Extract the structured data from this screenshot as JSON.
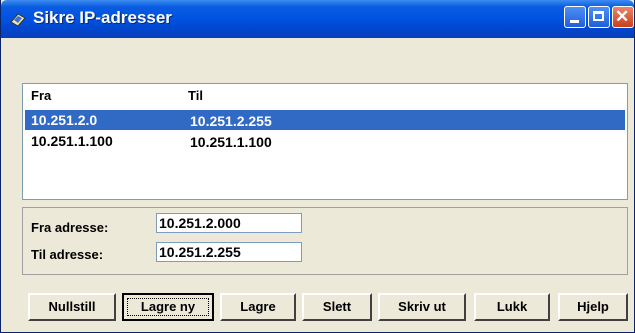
{
  "window": {
    "title": "Sikre IP-adresser",
    "colors": {
      "titlebar": "#0054e3",
      "selection": "#316ac5",
      "face": "#ece9d8"
    }
  },
  "list": {
    "headers": {
      "fra": "Fra",
      "til": "Til"
    },
    "rows": [
      {
        "fra": "10.251.2.0",
        "til": "10.251.2.255",
        "selected": true
      },
      {
        "fra": "10.251.1.100",
        "til": "10.251.1.100",
        "selected": false
      }
    ]
  },
  "form": {
    "fra_label": "Fra adresse:",
    "fra_value": "10.251.2.000",
    "til_label": "Til adresse:",
    "til_value": "10.251.2.255"
  },
  "buttons": {
    "nullstill": "Nullstill",
    "lagre_ny": "Lagre ny",
    "lagre": "Lagre",
    "slett": "Slett",
    "skriv_ut": "Skriv ut",
    "lukk": "Lukk",
    "hjelp": "Hjelp"
  }
}
